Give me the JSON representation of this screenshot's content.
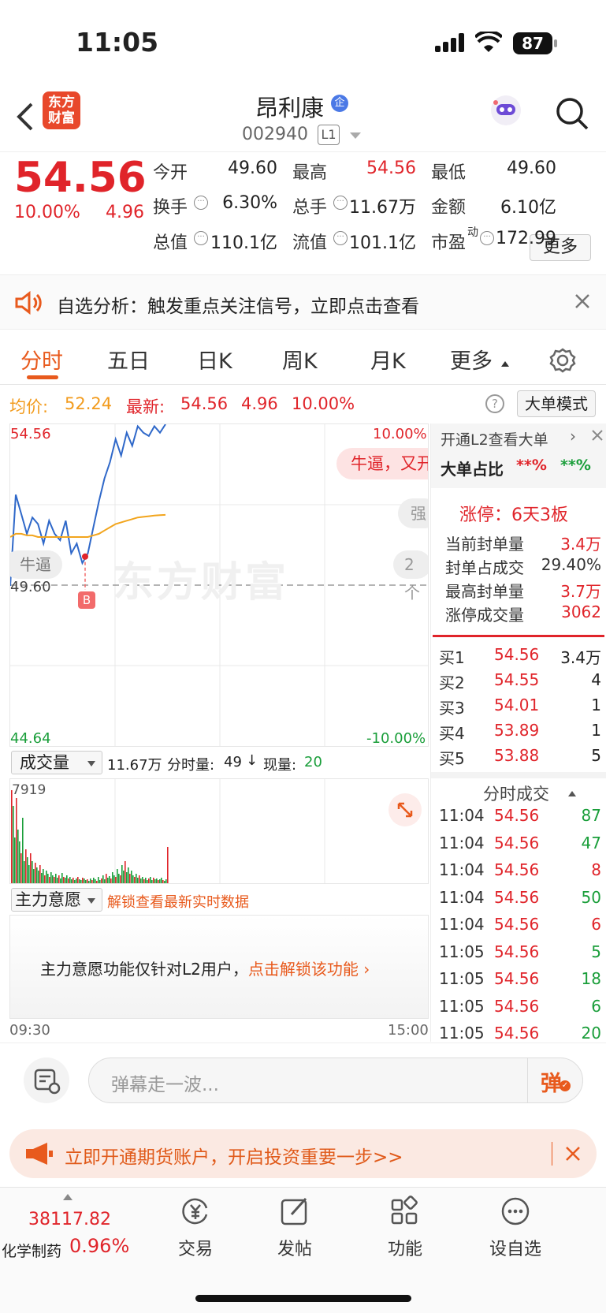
{
  "status": {
    "time": "11:05",
    "battery": "87"
  },
  "header": {
    "back_icon": "chevron-left-icon",
    "logo_text_1": "东方",
    "logo_text_2": "财富",
    "stock_name": "昂利康",
    "badge": "企",
    "code": "002940",
    "level": "L1"
  },
  "quote": {
    "price": "54.56",
    "pct": "10.00%",
    "change": "4.96",
    "items": [
      {
        "label": "今开",
        "value": "49.60",
        "color": "dark"
      },
      {
        "label": "最高",
        "value": "54.56",
        "color": "red"
      },
      {
        "label": "最低",
        "value": "49.60",
        "color": "dark"
      },
      {
        "label": "换手",
        "value": "6.30%",
        "color": "dark"
      },
      {
        "label": "总手",
        "value": "11.67万",
        "color": "dark"
      },
      {
        "label": "金额",
        "value": "6.10亿",
        "color": "dark"
      },
      {
        "label": "总值",
        "value": "110.1亿",
        "color": "dark"
      },
      {
        "label": "流值",
        "value": "101.1亿",
        "color": "dark"
      },
      {
        "label": "市盈",
        "sup": "动",
        "value": "172.99",
        "color": "dark"
      }
    ],
    "more_button": "更多"
  },
  "banner": {
    "text": "自选分析：触发重点关注信号，立即点击查看"
  },
  "tabs": [
    "分时",
    "五日",
    "日K",
    "周K",
    "月K",
    "更多"
  ],
  "chart_info": {
    "avg_label": "均价:",
    "avg_value": "52.24",
    "latest_label": "最新:",
    "latest_value": "54.56",
    "latest_change": "4.96",
    "latest_pct": "10.00%",
    "mode_button": "大单模式"
  },
  "chart": {
    "y_top": "54.56",
    "y_mid": "49.60",
    "y_bottom": "44.64",
    "pct_top": "10.00%",
    "pct_bottom": "-10.00%",
    "danmu_1": "牛逼，又开",
    "danmu_2": "强",
    "danmu_3": "牛逼",
    "danmu_4": "2个",
    "watermark": "东方财富",
    "buy_marker": "B",
    "x_start": "09:30",
    "x_end": "15:00"
  },
  "chart_data": {
    "type": "line",
    "series": [
      {
        "values": [
          49.6,
          52.4,
          51.8,
          51.2,
          51.7,
          51.5,
          50.9,
          51.6,
          51.2,
          51.0,
          51.6,
          50.6,
          50.9,
          50.3,
          50.6,
          51.4,
          52.2,
          52.9,
          53.4,
          54.1,
          53.6,
          54.3,
          53.9,
          54.5,
          54.3,
          54.2,
          54.5,
          54.3,
          54.56
        ]
      },
      {
        "values": [
          51.1,
          51.2,
          51.2,
          51.15,
          51.15,
          51.1,
          51.1,
          51.1,
          51.1,
          51.1,
          51.1,
          51.1,
          51.1,
          51.1,
          51.1,
          51.15,
          51.2,
          51.3,
          51.4,
          51.5,
          51.55,
          51.6,
          51.65,
          51.7,
          51.72,
          51.74,
          51.76,
          51.77,
          51.78
        ]
      }
    ],
    "ylim": [
      44.64,
      54.56
    ]
  },
  "volume": {
    "label": "成交量",
    "summary_total": "11.67万",
    "summary_label": "分时量:",
    "summary_value": "49",
    "current_label": "现量:",
    "current_value": "20",
    "max_label": "7919"
  },
  "power": {
    "label": "主力意愿",
    "unlock": "解锁查看最新实时数据",
    "notice": "主力意愿功能仅针对L2用户，",
    "notice_link": "点击解锁该功能"
  },
  "right_panel": {
    "l2_title": "开通L2查看大单",
    "big_ratio_label": "大单占比",
    "big_ratio_v1": "**%",
    "big_ratio_v2": "**%",
    "limit_title": "涨停：6天3板",
    "limit_rows": [
      {
        "label": "当前封单量",
        "value": "3.4万"
      },
      {
        "label": "封单占成交",
        "value": "29.40%"
      },
      {
        "label": "最高封单量",
        "value": "3.7万"
      },
      {
        "label": "涨停成交量",
        "value": "3062"
      }
    ],
    "order_book": [
      {
        "label": "买1",
        "price": "54.56",
        "vol": "3.4万"
      },
      {
        "label": "买2",
        "price": "54.55",
        "vol": "4"
      },
      {
        "label": "买3",
        "price": "54.01",
        "vol": "1"
      },
      {
        "label": "买4",
        "price": "53.89",
        "vol": "1"
      },
      {
        "label": "买5",
        "price": "53.88",
        "vol": "5"
      }
    ],
    "trades_title": "分时成交",
    "trades": [
      {
        "time": "11:04",
        "price": "54.56",
        "vol": "87"
      },
      {
        "time": "11:04",
        "price": "54.56",
        "vol": "47"
      },
      {
        "time": "11:04",
        "price": "54.56",
        "vol": "8"
      },
      {
        "time": "11:04",
        "price": "54.56",
        "vol": "50"
      },
      {
        "time": "11:04",
        "price": "54.56",
        "vol": "6"
      },
      {
        "time": "11:05",
        "price": "54.56",
        "vol": "5"
      },
      {
        "time": "11:05",
        "price": "54.56",
        "vol": "18"
      },
      {
        "time": "11:05",
        "price": "54.56",
        "vol": "6"
      },
      {
        "time": "11:05",
        "price": "54.56",
        "vol": "20"
      }
    ]
  },
  "comment": {
    "placeholder": "弹幕走一波...",
    "danmu_btn": "弹"
  },
  "ad": {
    "text": "立即开通期货账户，开启投资重要一步>>"
  },
  "bottom_nav": {
    "index_value": "38117.82",
    "index_name": "化学制药",
    "index_pct": "0.96%",
    "items": [
      "交易",
      "发帖",
      "功能",
      "设自选"
    ]
  }
}
